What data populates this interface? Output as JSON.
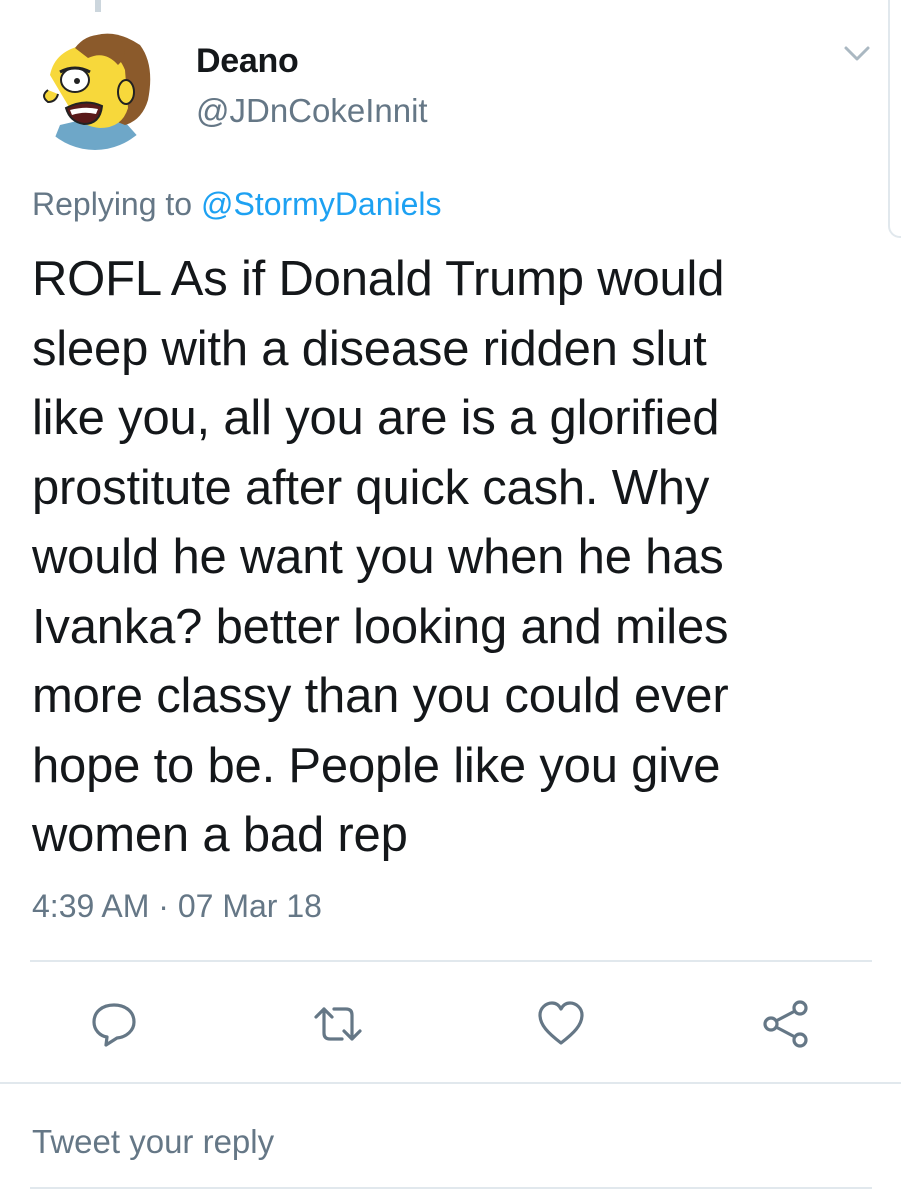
{
  "tweet": {
    "author": {
      "display_name": "Deano",
      "handle": "@JDnCokeInnit",
      "avatar_icon": "cartoon-avatar-icon"
    },
    "reply_context": {
      "prefix": "Replying to",
      "mention": "@StormyDaniels"
    },
    "text_lines": [
      "ROFL As if Donald Trump would",
      "sleep with a disease ridden slut",
      "like you, all you are is a glorified",
      "prostitute after quick cash. Why",
      "would he want you when he has",
      "Ivanka? better looking and miles",
      "more classy than you could ever",
      "hope to be. People like you give",
      "women a bad rep"
    ],
    "timestamp": "4:39 AM · 07 Mar 18"
  },
  "actions": [
    {
      "name": "reply",
      "icon": "reply-icon"
    },
    {
      "name": "retweet",
      "icon": "retweet-icon"
    },
    {
      "name": "like",
      "icon": "heart-icon"
    },
    {
      "name": "share",
      "icon": "share-icon"
    }
  ],
  "menu_icon": "chevron-down-icon",
  "reply_input": {
    "placeholder": "Tweet your reply"
  },
  "colors": {
    "text_primary": "#14171a",
    "text_secondary": "#657786",
    "link_blue": "#1da1f2",
    "divider": "#e1e8ed"
  }
}
